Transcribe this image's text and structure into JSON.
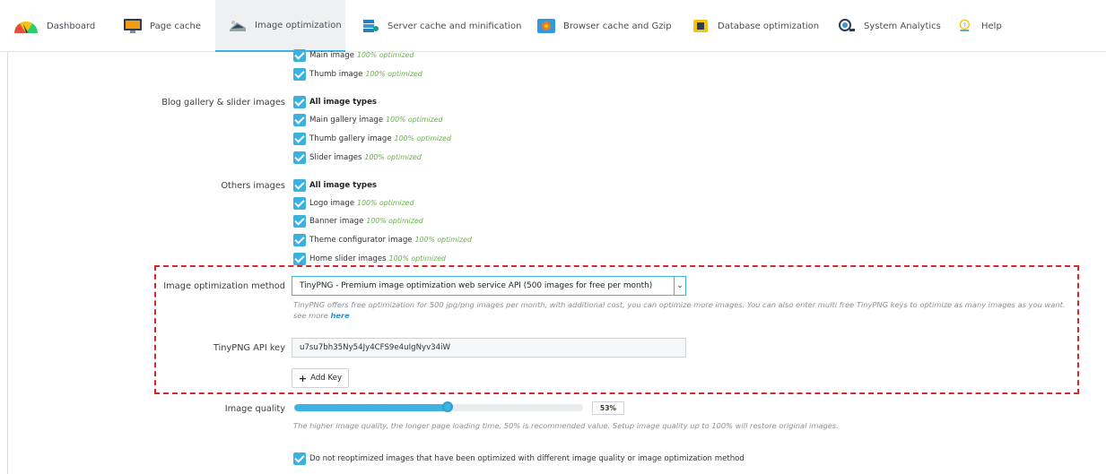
{
  "nav": {
    "tabs": [
      {
        "label": "Dashboard",
        "icon": "gauge-icon"
      },
      {
        "label": "Page cache",
        "icon": "monitor-icon"
      },
      {
        "label": "Image optimization",
        "icon": "image-icon",
        "active": true
      },
      {
        "label": "Server cache and minification",
        "icon": "server-icon"
      },
      {
        "label": "Browser cache and Gzip",
        "icon": "browser-icon"
      },
      {
        "label": "Database optimization",
        "icon": "database-icon"
      },
      {
        "label": "System Analytics",
        "icon": "analytics-icon"
      },
      {
        "label": "Help",
        "icon": "help-icon"
      }
    ]
  },
  "optimized_tag": "100% optimized",
  "sections": {
    "product_partial": {
      "items": [
        "Main image",
        "Thumb image"
      ]
    },
    "blog": {
      "label": "Blog gallery & slider images",
      "all_label": "All image types",
      "items": [
        "Main gallery image",
        "Thumb gallery image",
        "Slider images"
      ]
    },
    "others": {
      "label": "Others images",
      "all_label": "All image types",
      "items": [
        "Logo image",
        "Banner image",
        "Theme configurator image",
        "Home slider images"
      ]
    }
  },
  "method": {
    "label": "Image optimization method",
    "selected": "TinyPNG - Premium image optimization web service API (500 images for free per month)",
    "help": "TinyPNG offers free optimization for 500 jpg/png images per month, with additional cost, you can optimize more images. You can also enter multi free TinyPNG keys to optimize as many images as you want. see more",
    "help_link": "here"
  },
  "api_key": {
    "label": "TinyPNG API key",
    "value": "u7su7bh35Ny54Jy4CFS9e4uIgNyv34iW",
    "add_label": "Add Key"
  },
  "quality": {
    "label": "Image quality",
    "value": 53,
    "value_text": "53%",
    "help": "The higher image quality, the longer page loading time, 50% is recommended value. Setup image quality up to 100% will restore original images."
  },
  "reoptimize": {
    "label": "Do not reoptimized images that have been optimized with different image quality or image optimization method"
  },
  "colors": {
    "accent": "#3eb3e2",
    "optimized_green": "#6ab04c",
    "highlight_border": "#d9262a"
  }
}
